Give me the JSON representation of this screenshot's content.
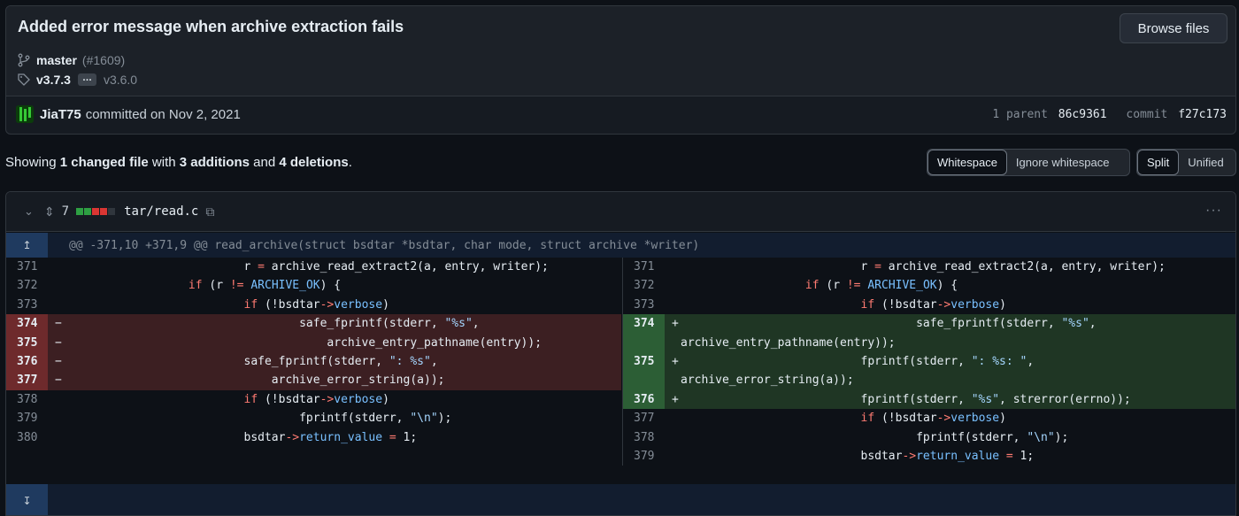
{
  "commit": {
    "title": "Added error message when archive extraction fails",
    "browse_label": "Browse files",
    "branch": "master",
    "pr": "(#1609)",
    "tag_new": "v3.7.3",
    "tag_more": "…",
    "tag_old": "v3.6.0",
    "author": "JiaT75",
    "committed_text": "committed on Nov 2, 2021",
    "parent_label": "1 parent",
    "parent_hash": "86c9361",
    "commit_label": "commit",
    "commit_hash": "f27c173"
  },
  "summary": {
    "prefix": "Showing",
    "files": "1 changed file",
    "with": "with",
    "additions": "3 additions",
    "and": "and",
    "deletions": "4 deletions",
    "period": "."
  },
  "toggles": {
    "whitespace": "Whitespace",
    "ignore_whitespace": "Ignore whitespace",
    "split": "Split",
    "unified": "Unified"
  },
  "file": {
    "changes": "7",
    "name": "tar/read.c",
    "colors": {
      "added": "#2ea043",
      "deleted": "#da3633",
      "neutral": "#30363d"
    },
    "hunk_header": "@@ -371,10 +371,9 @@ read_archive(struct bsdtar *bsdtar, char mode, struct archive *writer)"
  },
  "left_lines": [
    {
      "n": "371",
      "type": "ctx",
      "code": "                          r = archive_read_extract2(a, entry, writer);"
    },
    {
      "n": "372",
      "type": "ctx",
      "code": "                  if (r != ARCHIVE_OK) {"
    },
    {
      "n": "373",
      "type": "ctx",
      "code": "                          if (!bsdtar->verbose)"
    },
    {
      "n": "374",
      "type": "del",
      "code": "                                  safe_fprintf(stderr, \"%s\","
    },
    {
      "n": "",
      "type": "del",
      "code": ""
    },
    {
      "n": "375",
      "type": "del",
      "code": "                                      archive_entry_pathname(entry));"
    },
    {
      "n": "",
      "type": "del",
      "code": ""
    },
    {
      "n": "376",
      "type": "del",
      "code": "                          safe_fprintf(stderr, \": %s\","
    },
    {
      "n": "377",
      "type": "del",
      "code": "                              archive_error_string(a));"
    },
    {
      "n": "378",
      "type": "ctx",
      "code": "                          if (!bsdtar->verbose)"
    },
    {
      "n": "379",
      "type": "ctx",
      "code": "                                  fprintf(stderr, \"\\n\");"
    },
    {
      "n": "380",
      "type": "ctx",
      "code": "                          bsdtar->return_value = 1;"
    }
  ],
  "right_lines": [
    {
      "n": "371",
      "type": "ctx",
      "code": "                          r = archive_read_extract2(a, entry, writer);"
    },
    {
      "n": "372",
      "type": "ctx",
      "code": "                  if (r != ARCHIVE_OK) {"
    },
    {
      "n": "373",
      "type": "ctx",
      "code": "                          if (!bsdtar->verbose)"
    },
    {
      "n": "374",
      "type": "add",
      "code": "                                  safe_fprintf(stderr, \"%s\","
    },
    {
      "n": "",
      "type": "add",
      "code": "archive_entry_pathname(entry));"
    },
    {
      "n": "375",
      "type": "add",
      "code": "                          fprintf(stderr, \": %s: \","
    },
    {
      "n": "",
      "type": "add",
      "code": "archive_error_string(a));"
    },
    {
      "n": "376",
      "type": "add",
      "code": "                          fprintf(stderr, \"%s\", strerror(errno));"
    },
    {
      "n": "",
      "type": "empty",
      "code": ""
    },
    {
      "n": "377",
      "type": "ctx",
      "code": "                          if (!bsdtar->verbose)"
    },
    {
      "n": "378",
      "type": "ctx",
      "code": "                                  fprintf(stderr, \"\\n\");"
    },
    {
      "n": "379",
      "type": "ctx",
      "code": "                          bsdtar->return_value = 1;"
    }
  ]
}
